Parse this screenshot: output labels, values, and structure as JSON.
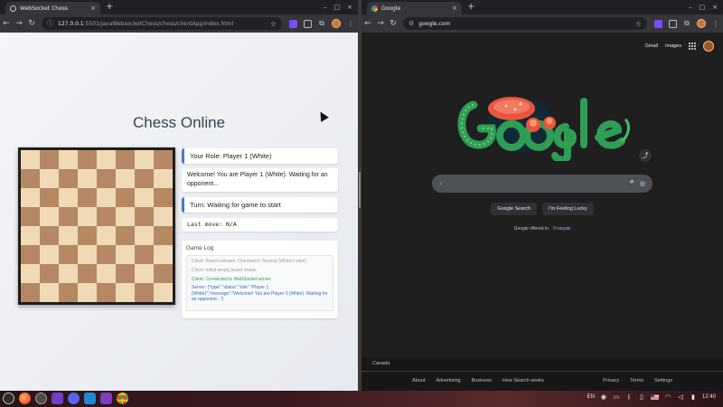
{
  "left_window": {
    "tab": {
      "title": "WebSocket Chess",
      "close": "×"
    },
    "new_tab": "+",
    "window_controls": {
      "minimize": "–",
      "maximize": "□",
      "close": "×"
    },
    "nav": {
      "back": "←",
      "forward": "→",
      "reload": "↻"
    },
    "url_host": "127.0.0.1",
    "url_path": ":5501/javaWebsocketChess/chess/clientApp/index.html",
    "page": {
      "title": "Chess Online",
      "board": {
        "light_square": "#f0d9b5",
        "dark_square": "#b58863"
      },
      "role": "Your Role: Player 1 (White)",
      "message": "Welcome! You are Player 1 (White). Waiting for an opponent...",
      "turn": "Turn: Waiting for game to start",
      "last_move": "Last move: N/A",
      "log_title": "Game Log",
      "log": [
        {
          "text": "Client: Board redrawn. Orientation: Normal (White's view)",
          "kind": "client"
        },
        {
          "text": "Client: Initial empty board drawn.",
          "kind": "client"
        },
        {
          "text": "Client: Connected to WebSocket server.",
          "kind": "success"
        },
        {
          "text": "Server: {\"type\":\"status\",\"role\":\"Player 1 (White)\",\"message\":\"Welcome! You are Player 1 (White). Waiting for an opponent...\"}",
          "kind": "server"
        }
      ]
    }
  },
  "right_window": {
    "tab": {
      "title": "Google",
      "close": "×"
    },
    "new_tab": "+",
    "window_controls": {
      "minimize": "–",
      "maximize": "□",
      "close": "×"
    },
    "nav": {
      "back": "←",
      "forward": "→",
      "reload": "↻"
    },
    "url": "google.com",
    "page": {
      "top_links": [
        "Gmail",
        "Images"
      ],
      "search_placeholder": "",
      "buttons": {
        "search": "Google Search",
        "lucky": "I'm Feeling Lucky"
      },
      "offered_in": "Google offered in:",
      "offered_lang": "Français",
      "country": "Canada",
      "footer_left": [
        "About",
        "Advertising",
        "Business",
        "How Search works"
      ],
      "footer_right": [
        "Privacy",
        "Terms",
        "Settings"
      ]
    }
  },
  "taskbar": {
    "apps": [
      "launcher-icon",
      "firefox-icon",
      "files-icon",
      "terminal-icon",
      "discord-icon",
      "vscode-icon",
      "mail-icon",
      "chrome-icon"
    ],
    "tray": {
      "language": "EN",
      "time": "12:40"
    }
  },
  "colors": {
    "accent_blue": "#4a78c2",
    "log_success": "#2e9b4a",
    "log_server": "#2e6fb0"
  }
}
